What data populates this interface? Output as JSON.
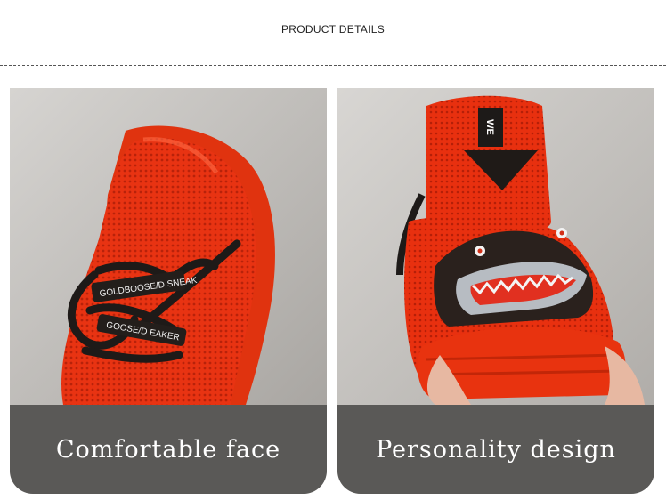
{
  "header": {
    "title": "PRODUCT DETAILS"
  },
  "panels": [
    {
      "caption": "Comfortable face",
      "lace_text_1": "GOLDBOOSE/D SNEAK",
      "lace_text_2": "GOOSE/D EAKER"
    },
    {
      "caption": "Personality design",
      "tab_text": "WE"
    }
  ],
  "colors": {
    "shoe_red": "#e8300f",
    "caption_band": "#5a5957",
    "background_gray": "#c9c7c4"
  }
}
